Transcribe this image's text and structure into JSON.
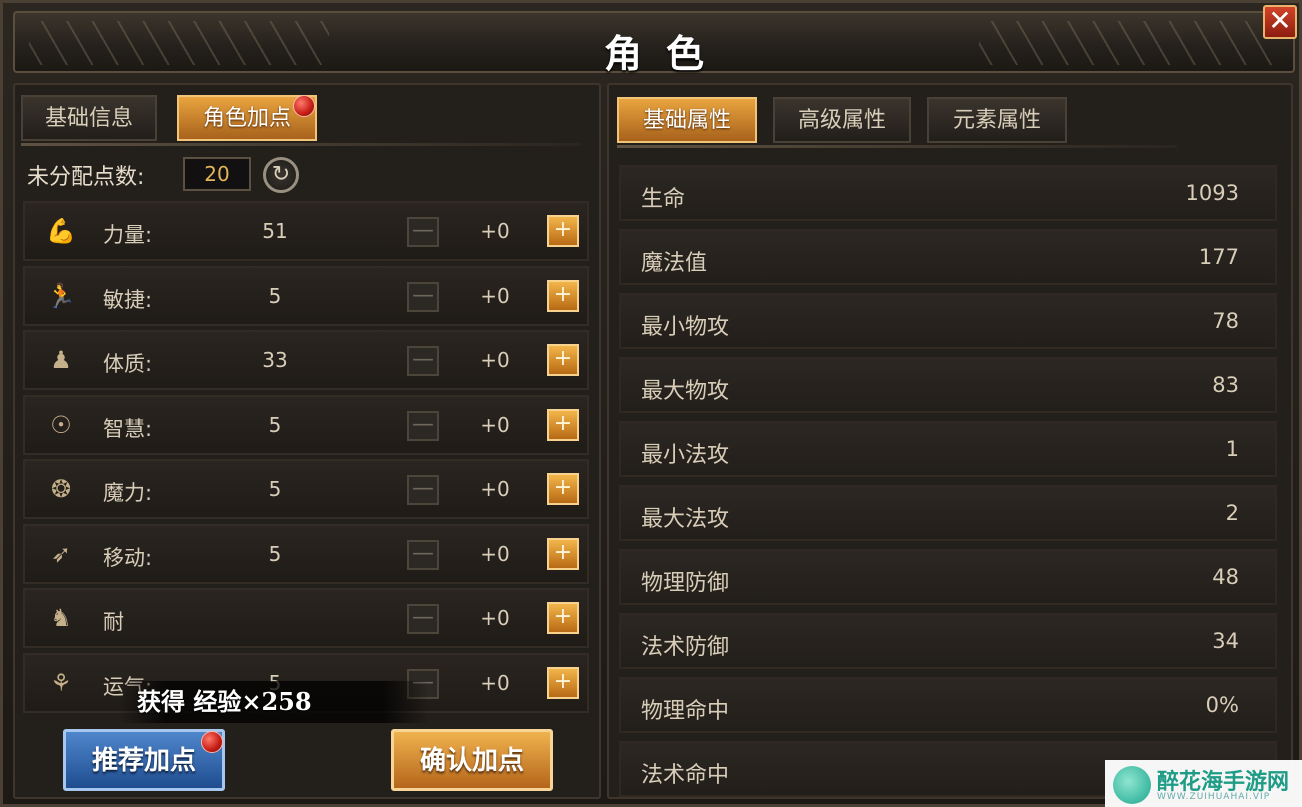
{
  "window": {
    "title": "角色",
    "close_label": "✕"
  },
  "left_tabs": [
    {
      "label": "基础信息",
      "active": false
    },
    {
      "label": "角色加点",
      "active": true,
      "badge": true
    }
  ],
  "unassigned": {
    "label": "未分配点数:",
    "value": "20",
    "reset_icon": "↻"
  },
  "stats": [
    {
      "icon": "arm-icon",
      "glyph": "💪",
      "label": "力量:",
      "value": "51",
      "add": "+0"
    },
    {
      "icon": "agility-icon",
      "glyph": "🏃",
      "label": "敏捷:",
      "value": "5",
      "add": "+0"
    },
    {
      "icon": "body-icon",
      "glyph": "♟",
      "label": "体质:",
      "value": "33",
      "add": "+0"
    },
    {
      "icon": "wisdom-icon",
      "glyph": "☉",
      "label": "智慧:",
      "value": "5",
      "add": "+0"
    },
    {
      "icon": "brain-icon",
      "glyph": "❂",
      "label": "魔力:",
      "value": "5",
      "add": "+0"
    },
    {
      "icon": "move-icon",
      "glyph": "➶",
      "label": "移动:",
      "value": "5",
      "add": "+0"
    },
    {
      "icon": "endurance-icon",
      "glyph": "♞",
      "label": "耐",
      "value": "",
      "add": "+0"
    },
    {
      "icon": "luck-icon",
      "glyph": "⚘",
      "label": "运气:",
      "value": "5",
      "add": "+0"
    }
  ],
  "stat_buttons": {
    "minus": "—",
    "plus": "+"
  },
  "toast": "获得 经验×258",
  "buttons": {
    "recommend": "推荐加点",
    "confirm": "确认加点"
  },
  "right_tabs": [
    {
      "label": "基础属性",
      "active": true
    },
    {
      "label": "高级属性",
      "active": false
    },
    {
      "label": "元素属性",
      "active": false
    }
  ],
  "attributes": [
    {
      "label": "生命",
      "value": "1093"
    },
    {
      "label": "魔法值",
      "value": "177"
    },
    {
      "label": "最小物攻",
      "value": "78"
    },
    {
      "label": "最大物攻",
      "value": "83"
    },
    {
      "label": "最小法攻",
      "value": "1"
    },
    {
      "label": "最大法攻",
      "value": "2"
    },
    {
      "label": "物理防御",
      "value": "48"
    },
    {
      "label": "法术防御",
      "value": "34"
    },
    {
      "label": "物理命中",
      "value": "0%"
    },
    {
      "label": "法术命中",
      "value": ""
    }
  ],
  "watermark": {
    "name": "醉花海手游网",
    "sub": "WWW.ZUIHUAHAI.VIP"
  }
}
